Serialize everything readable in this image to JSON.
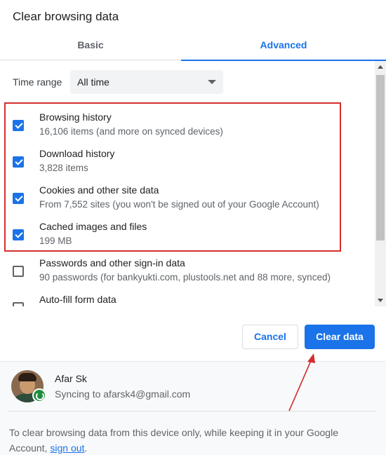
{
  "dialog": {
    "title": "Clear browsing data"
  },
  "tabs": [
    {
      "label": "Basic",
      "active": false
    },
    {
      "label": "Advanced",
      "active": true
    }
  ],
  "time_range": {
    "label": "Time range",
    "selected": "All time"
  },
  "options": [
    {
      "label": "Browsing history",
      "detail": "16,106 items (and more on synced devices)",
      "checked": true
    },
    {
      "label": "Download history",
      "detail": "3,828 items",
      "checked": true
    },
    {
      "label": "Cookies and other site data",
      "detail": "From 7,552 sites (you won't be signed out of your Google Account)",
      "checked": true
    },
    {
      "label": "Cached images and files",
      "detail": "199 MB",
      "checked": true
    },
    {
      "label": "Passwords and other sign-in data",
      "detail": "90 passwords (for bankyukti.com, plustools.net and 88 more, synced)",
      "checked": false
    },
    {
      "label": "Auto-fill form data",
      "detail": "",
      "checked": false
    }
  ],
  "buttons": {
    "cancel": "Cancel",
    "clear": "Clear data"
  },
  "account": {
    "name": "Afar Sk",
    "sync_status": "Syncing to afarsk4@gmail.com"
  },
  "footer": {
    "note_prefix": "To clear browsing data from this device only, while keeping it in your Google Account, ",
    "sign_out_link": "sign out",
    "note_suffix": "."
  },
  "colors": {
    "accent": "#1a73e8",
    "annotation": "#d32f2f",
    "sync_badge": "#1e8e3e"
  },
  "icons": {
    "dropdown": "caret-down-icon",
    "sync": "sync-icon",
    "checkbox": "checkbox-icon"
  }
}
